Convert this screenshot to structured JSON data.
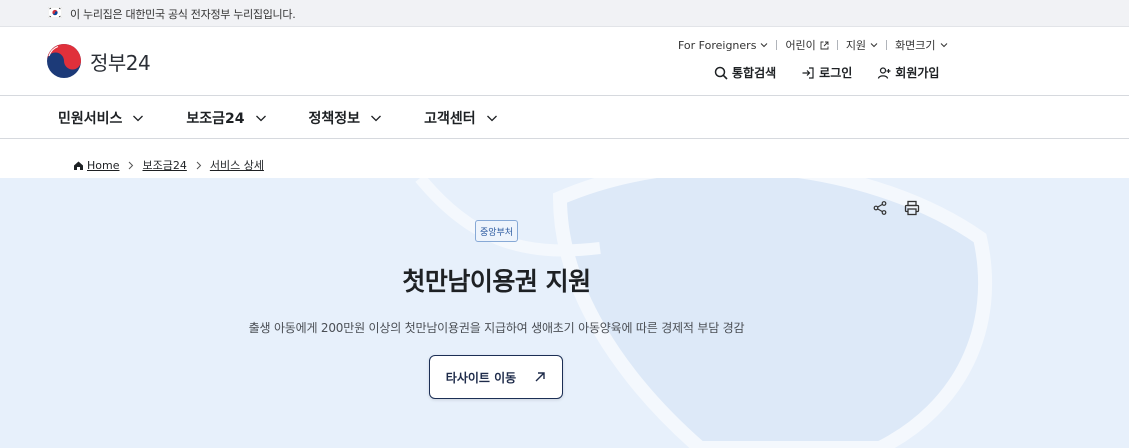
{
  "gov_banner": {
    "text": "이 누리집은 대한민국 공식 전자정부 누리집입니다."
  },
  "header": {
    "logo_text": "정부24",
    "utility_links": [
      {
        "label": "For Foreigners",
        "icon": "chevron-down-icon"
      },
      {
        "label": "어린이",
        "icon": "external-link-icon"
      },
      {
        "label": "지원",
        "icon": "chevron-down-icon"
      },
      {
        "label": "화면크기",
        "icon": "chevron-down-icon"
      }
    ],
    "actions": [
      {
        "label": "통합검색",
        "icon": "search-icon"
      },
      {
        "label": "로그인",
        "icon": "login-icon"
      },
      {
        "label": "회원가입",
        "icon": "user-add-icon"
      }
    ]
  },
  "nav": {
    "items": [
      {
        "label": "민원서비스"
      },
      {
        "label": "보조금24"
      },
      {
        "label": "정책정보"
      },
      {
        "label": "고객센터"
      }
    ]
  },
  "breadcrumb": [
    "Home",
    "보조금24",
    "서비스 상세"
  ],
  "hero": {
    "badge": "중앙부처",
    "title": "첫만남이용권 지원",
    "description": "출생 아동에게 200만원 이상의 첫만남이용권을 지급하여 생애초기 아동양육에 따른 경제적 부담 경감",
    "button_label": "타사이트 이동"
  },
  "colors": {
    "hero_bg": "#e7f0fb",
    "button_border": "#1c2f55",
    "badge_border": "#87a9d6"
  }
}
